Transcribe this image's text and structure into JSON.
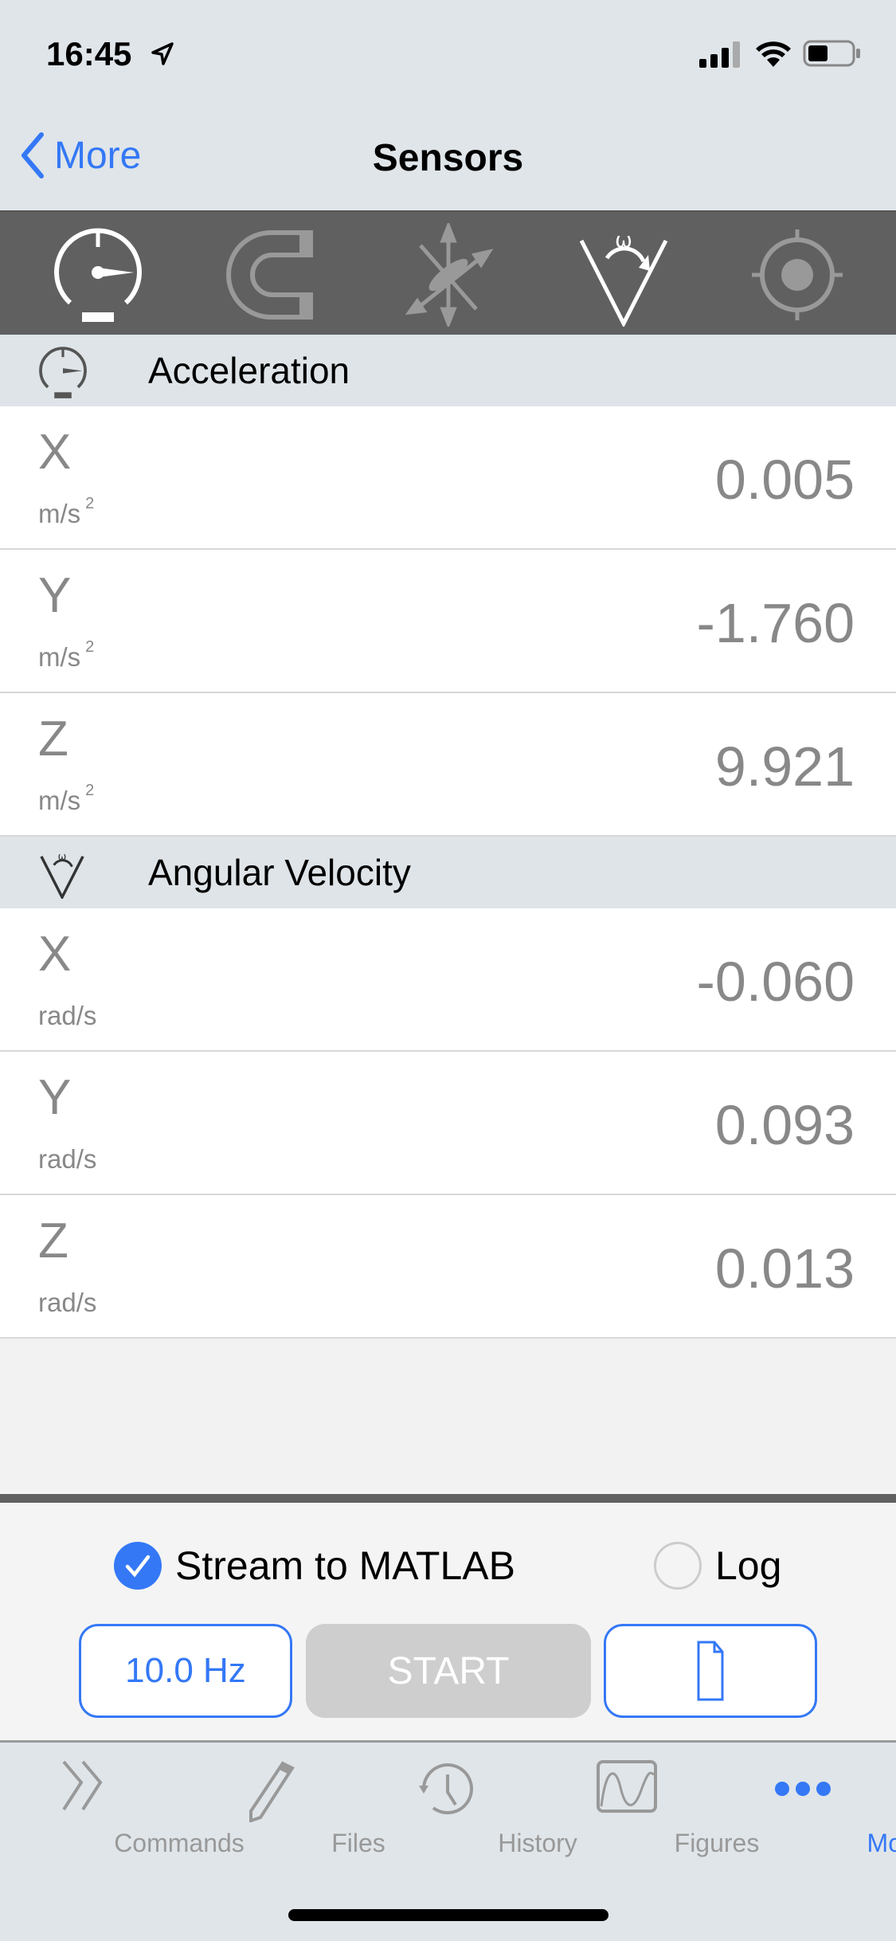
{
  "status_bar": {
    "time": "16:45"
  },
  "nav": {
    "back_label": "More",
    "title": "Sensors"
  },
  "sensor_toolbar": {
    "items": [
      {
        "icon": "accelerometer-gauge-icon",
        "selected": true
      },
      {
        "icon": "magnet-icon",
        "selected": false
      },
      {
        "icon": "orientation-axes-icon",
        "selected": false
      },
      {
        "icon": "angular-velocity-icon",
        "selected": true
      },
      {
        "icon": "position-target-icon",
        "selected": false
      }
    ]
  },
  "sections": [
    {
      "title": "Acceleration",
      "rows": [
        {
          "axis": "X",
          "unit": "m/s",
          "exp": "2",
          "value": "0.005"
        },
        {
          "axis": "Y",
          "unit": "m/s",
          "exp": "2",
          "value": "-1.760"
        },
        {
          "axis": "Z",
          "unit": "m/s",
          "exp": "2",
          "value": "9.921"
        }
      ]
    },
    {
      "title": "Angular Velocity",
      "rows": [
        {
          "axis": "X",
          "unit": "rad/s",
          "value": "-0.060"
        },
        {
          "axis": "Y",
          "unit": "rad/s",
          "value": "0.093"
        },
        {
          "axis": "Z",
          "unit": "rad/s",
          "value": "0.013"
        }
      ]
    }
  ],
  "controls": {
    "stream_label": "Stream to MATLAB",
    "stream_checked": true,
    "log_label": "Log",
    "log_checked": false,
    "rate_label": "10.0 Hz",
    "start_label": "START"
  },
  "tabbar": {
    "items": [
      {
        "label": "Commands",
        "active": false
      },
      {
        "label": "Files",
        "active": false
      },
      {
        "label": "History",
        "active": false
      },
      {
        "label": "Figures",
        "active": false
      },
      {
        "label": "More",
        "active": true
      }
    ]
  },
  "colors": {
    "accent": "#3478f6",
    "toolbar": "#606060",
    "header": "#dee4e8"
  }
}
